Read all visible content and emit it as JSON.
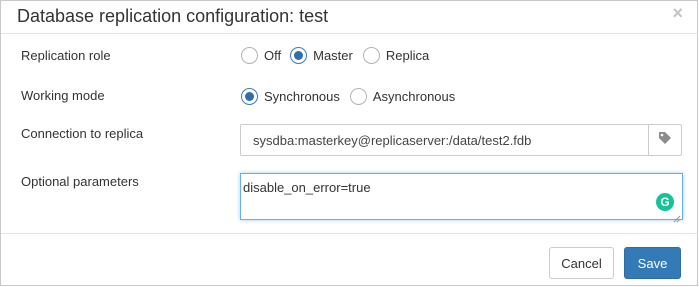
{
  "dialog": {
    "title": "Database replication configuration: test",
    "close_label": "×"
  },
  "replication_role": {
    "label": "Replication role",
    "options": [
      {
        "label": "Off",
        "checked": false
      },
      {
        "label": "Master",
        "checked": true
      },
      {
        "label": "Replica",
        "checked": false
      }
    ]
  },
  "working_mode": {
    "label": "Working mode",
    "options": [
      {
        "label": "Synchronous",
        "checked": true
      },
      {
        "label": "Asynchronous",
        "checked": false
      }
    ]
  },
  "connection": {
    "label": "Connection to replica",
    "value": "sysdba:masterkey@replicaserver:/data/test2.fdb",
    "addon_icon": "tag-icon"
  },
  "optional_parameters": {
    "label": "Optional parameters",
    "value": "disable_on_error=true",
    "assistant_icon": "grammarly-icon",
    "assistant_glyph": "G"
  },
  "footer": {
    "cancel_label": "Cancel",
    "save_label": "Save"
  },
  "colors": {
    "primary": "#337ab7",
    "radio_checked": "#2f6ea8",
    "focus_border": "#66afe9",
    "grammarly": "#15c39a"
  }
}
